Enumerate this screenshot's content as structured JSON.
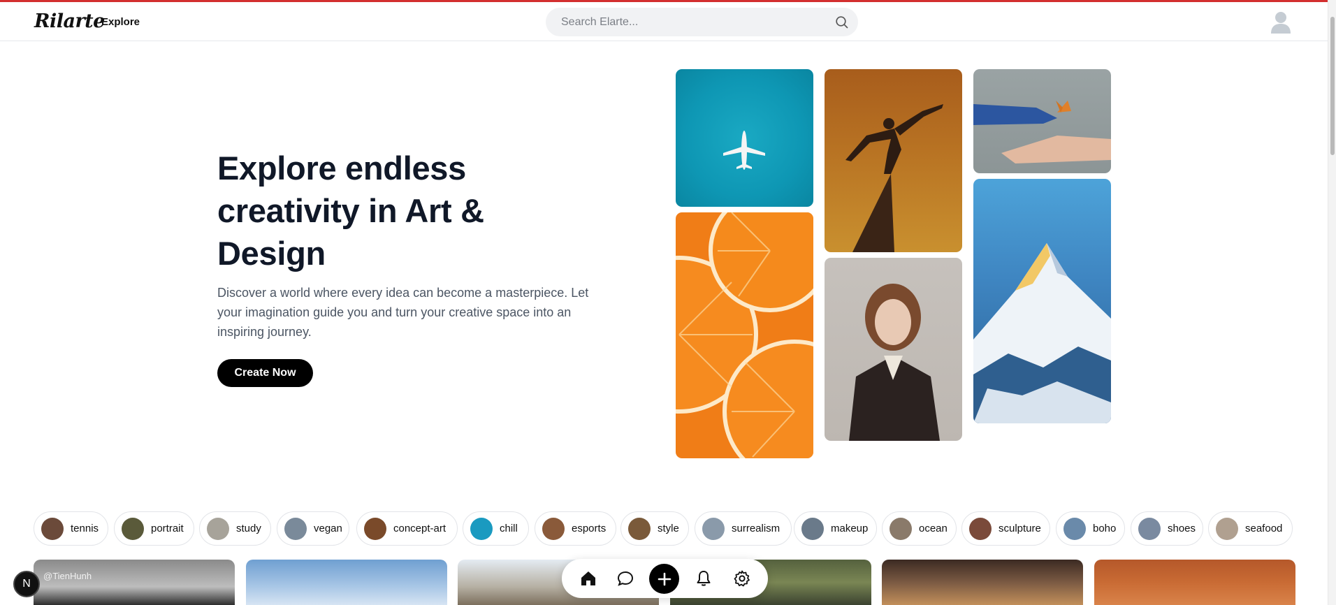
{
  "header": {
    "logo": "Rilarte",
    "nav_explore": "Explore",
    "search_placeholder": "Search Elarte...",
    "accent_color": "#d32f2f"
  },
  "hero": {
    "title": "Explore endless creativity in Art & Design",
    "subtitle": "Discover a world where every idea can become a masterpiece. Let your imagination guide you and turn your creative space into an inspiring journey.",
    "cta_label": "Create Now"
  },
  "categories": [
    {
      "label": "tennis",
      "color": "#6b4a3a"
    },
    {
      "label": "portrait",
      "color": "#5a5a3a"
    },
    {
      "label": "study",
      "color": "#a7a39a"
    },
    {
      "label": "vegan",
      "color": "#7a8a9a"
    },
    {
      "label": "concept-art",
      "color": "#7a4a2a"
    },
    {
      "label": "chill",
      "color": "#1a9ac0"
    },
    {
      "label": "esports",
      "color": "#8a5a3a"
    },
    {
      "label": "style",
      "color": "#7a5a3a"
    },
    {
      "label": "surrealism",
      "color": "#8a9aaa"
    },
    {
      "label": "makeup",
      "color": "#6a7a8a"
    },
    {
      "label": "ocean",
      "color": "#8a7a6a"
    },
    {
      "label": "sculpture",
      "color": "#7a4a3a"
    },
    {
      "label": "boho",
      "color": "#6a8aaa"
    },
    {
      "label": "shoes",
      "color": "#7a8aa0"
    },
    {
      "label": "seafood",
      "color": "#b0a090"
    }
  ],
  "feed": {
    "first_author": "@TienHunh"
  },
  "dock": {
    "items": [
      "home-icon",
      "chat-icon",
      "plus-icon",
      "bell-icon",
      "gear-icon"
    ]
  },
  "badge": {
    "letter": "N"
  }
}
